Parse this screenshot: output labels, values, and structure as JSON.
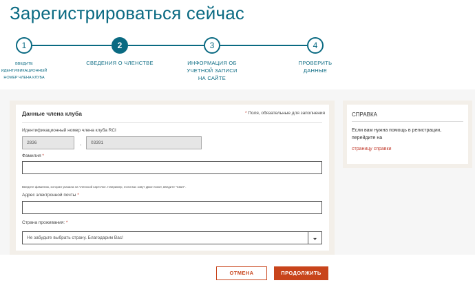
{
  "page": {
    "title": "Зарегистрироваться сейчас"
  },
  "stepper": {
    "steps": [
      {
        "number": "1",
        "label": "введите идентификационный номер члена клуба",
        "active": false
      },
      {
        "number": "2",
        "label": "СВЕДЕНИЯ О ЧЛЕНСТВЕ",
        "active": true
      },
      {
        "number": "3",
        "label": "ИНФОРМАЦИЯ ОБ УЧЕТНОЙ ЗАПИСИ НА САЙТЕ",
        "active": false
      },
      {
        "number": "4",
        "label": "ПРОВЕРИТЬ ДАННЫЕ",
        "active": false
      }
    ]
  },
  "form": {
    "section_title": "Данные члена клуба",
    "required_star": "*",
    "required_note": "Поля, обязательные для заполнения",
    "member_id": {
      "label": "Идентификационный номер члена клуба RCI",
      "part1": "2836",
      "separator": "-",
      "part2": "03391"
    },
    "last_name": {
      "label": "Фамилия",
      "star": "*",
      "value": "",
      "hint": "Введите фамилию, которая указана на членской карточке. Например, если вас зовут Джон Смит, введите \"Смит\"."
    },
    "email": {
      "label": "Адрес электронной почты",
      "star": "*",
      "value": ""
    },
    "country": {
      "label": "Страна проживания:",
      "star": "*",
      "selected": "Не забудьте выбрать страну. Благодарим Вас!"
    }
  },
  "help": {
    "title": "СПРАВКА",
    "text": "Если вам нужна помощь в регистрации, перейдите на",
    "link": "страницу справки"
  },
  "buttons": {
    "cancel": "ОТМЕНА",
    "continue": "ПРОДОЛЖИТЬ"
  },
  "colors": {
    "accent": "#0a6a82",
    "action": "#c8441b",
    "panel": "#f3efe9"
  }
}
